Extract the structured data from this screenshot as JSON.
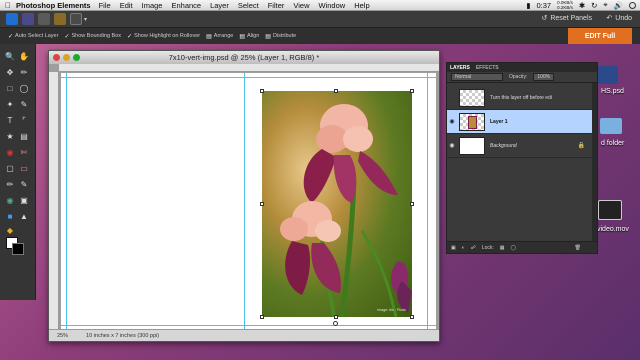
{
  "menubar": {
    "app_name": "Photoshop Elements",
    "items": [
      "File",
      "Edit",
      "Image",
      "Enhance",
      "Layer",
      "Select",
      "Filter",
      "View",
      "Window",
      "Help"
    ],
    "battery_time": "0:37",
    "net_up": "0.0KB/s",
    "net_down": "0.2KB/s"
  },
  "appbar": {
    "reset_panels": "Reset Panels",
    "undo": "Undo"
  },
  "options": {
    "auto_select": "Auto Select Layer",
    "bounding_box": "Show Bounding Box",
    "highlight": "Show Highlight on Rollover",
    "arrange": "Arrange",
    "align": "Align",
    "distribute": "Distribute"
  },
  "edit_mode": "EDIT Full",
  "document": {
    "title": "7x10-vert-img.psd @ 25% (Layer 1, RGB/8) *",
    "zoom": "25%",
    "doc_size": "10 inches x 7 inches (300 ppi)",
    "photo_credit": "Image: Iris · Photo"
  },
  "layers_panel": {
    "tab_layers": "LAYERS",
    "tab_effects": "EFFECTS",
    "blend_mode": "Normal",
    "opacity_label": "Opacity:",
    "opacity_value": "100%",
    "layers": [
      {
        "name": "Turn this layer off before edi",
        "selected": false
      },
      {
        "name": "Layer 1",
        "selected": true
      },
      {
        "name": "Background",
        "selected": false
      }
    ],
    "lock_label": "Lock:"
  },
  "desktop": {
    "file1": "HS.psd",
    "file2": "d folder",
    "file3": "video.mov"
  },
  "colors": {
    "accent_orange": "#e0701f",
    "selection_blue": "#b4d4ff",
    "guide_cyan": "#4fc3e6"
  }
}
